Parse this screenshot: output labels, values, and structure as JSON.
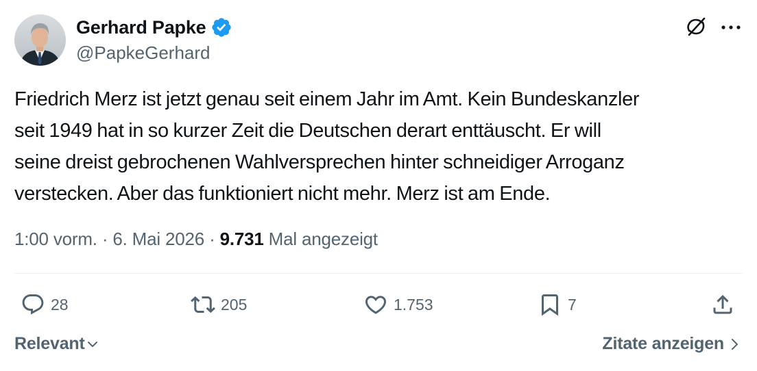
{
  "author": {
    "display_name": "Gerhard Papke",
    "handle": "@PapkeGerhard",
    "verified": true,
    "verified_color": "#1d9bf0",
    "avatar_icon": "profile-photo"
  },
  "tweet": {
    "text": "Friedrich Merz ist jetzt genau seit einem Jahr im Amt. Kein Bundeskanzler\nseit 1949 hat in so kurzer Zeit die Deutschen derart enttäuscht. Er will\nseine dreist gebrochenen Wahlversprechen hinter schneidiger Arroganz\nverstecken. Aber das funktioniert nicht mehr. Merz ist am Ende."
  },
  "meta": {
    "time": "1:00 vorm.",
    "separator": "·",
    "date": "6. Mai 2026",
    "views_count": "9.731",
    "views_label": "Mal angezeigt"
  },
  "actions": {
    "replies": "28",
    "reposts": "205",
    "likes": "1.753",
    "bookmarks": "7"
  },
  "footer": {
    "sort_label": "Relevant",
    "quotes_label": "Zitate anzeigen"
  },
  "icons": {
    "header": [
      "grok-icon",
      "more-icon"
    ],
    "actions": [
      "reply-icon",
      "repost-icon",
      "like-icon",
      "bookmark-icon",
      "share-icon"
    ]
  },
  "colors": {
    "text_primary": "#0f1419",
    "text_secondary": "#536471",
    "divider": "#eff3f4",
    "accent": "#1d9bf0"
  }
}
